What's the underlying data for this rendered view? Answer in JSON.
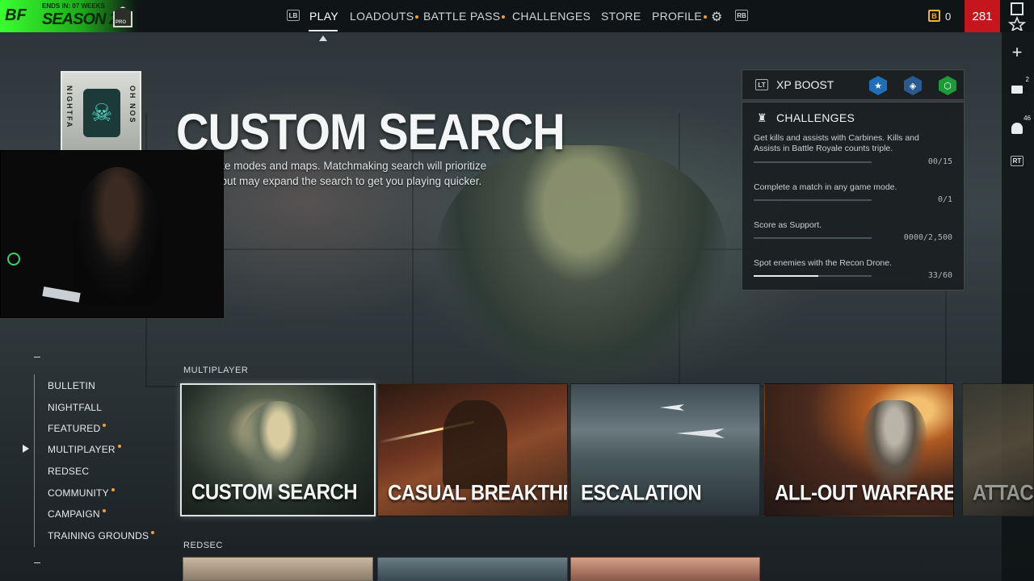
{
  "header": {
    "logo_text": "BF",
    "season_subtext": "ENDS IN: 07 WEEKS",
    "season_title": "SEASON 2",
    "rank_label": "PRO",
    "lb_key": "LB",
    "rb_key": "RB",
    "tabs": [
      {
        "label": "PLAY",
        "active": true,
        "dot": false
      },
      {
        "label": "LOADOUTS",
        "active": false,
        "dot": true
      },
      {
        "label": "BATTLE PASS",
        "active": false,
        "dot": true
      },
      {
        "label": "CHALLENGES",
        "active": false,
        "dot": false
      },
      {
        "label": "STORE",
        "active": false,
        "dot": false
      },
      {
        "label": "PROFILE",
        "active": false,
        "dot": true
      }
    ],
    "currency_icon_letter": "B",
    "currency_value": "0",
    "player_level": "281",
    "accent_red": "#c4161c",
    "accent_green": "#39ff2e",
    "notification_dot": "#f0a030"
  },
  "hero": {
    "title": "CUSTOM SEARCH",
    "description_line1": "our favorite modes and maps. Matchmaking search will prioritize",
    "description_line2": "ferences but may expand the search to get you playing quicker."
  },
  "banner": {
    "left_text": "NIGHTFA",
    "right_text": "OH NOS"
  },
  "right_rail": {
    "plus_badge": "",
    "mail_badge": "2",
    "squad_badge": "46",
    "rt_key": "RT"
  },
  "xp_boost": {
    "key": "LT",
    "label": "XP BOOST",
    "icons": [
      "star-icon",
      "shield-icon",
      "hex-icon"
    ],
    "icon_colors": [
      "#3aa0e8",
      "#3a80c8",
      "#2ec84a"
    ]
  },
  "challenges": {
    "title": "CHALLENGES",
    "items": [
      {
        "text": "Get kills and assists with Carbines. Kills and Assists in Battle Royale counts triple.",
        "progress": "00/15",
        "fraction": 0.0
      },
      {
        "text": "Complete a match in any game mode.",
        "progress": "0/1",
        "fraction": 0.0
      },
      {
        "text": "Score as Support.",
        "progress": "0000/2,500",
        "fraction": 0.0
      },
      {
        "text": "Spot enemies with the Recon Drone.",
        "progress": "33/60",
        "fraction": 0.55
      }
    ]
  },
  "menu": {
    "items": [
      {
        "label": "BULLETIN",
        "dot": false,
        "selected": false
      },
      {
        "label": "NIGHTFALL",
        "dot": false,
        "selected": false
      },
      {
        "label": "FEATURED",
        "dot": true,
        "selected": false
      },
      {
        "label": "MULTIPLAYER",
        "dot": true,
        "selected": true
      },
      {
        "label": "REDSEC",
        "dot": false,
        "selected": false
      },
      {
        "label": "COMMUNITY",
        "dot": true,
        "selected": false
      },
      {
        "label": "CAMPAIGN",
        "dot": true,
        "selected": false
      },
      {
        "label": "TRAINING GROUNDS",
        "dot": true,
        "selected": false
      }
    ]
  },
  "sections": {
    "multiplayer_label": "MULTIPLAYER",
    "multiplayer_cards": [
      {
        "title": "CUSTOM SEARCH",
        "selected": true
      },
      {
        "title": "CASUAL BREAKTHROUGH",
        "selected": false
      },
      {
        "title": "ESCALATION",
        "selected": false
      },
      {
        "title": "ALL-OUT WARFARE",
        "selected": false
      },
      {
        "title": "ATTACK &",
        "selected": false
      }
    ],
    "redsec_label": "REDSEC"
  }
}
